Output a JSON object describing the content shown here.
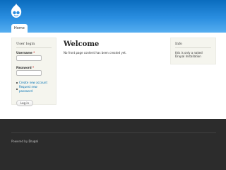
{
  "header": {
    "nav_tabs": [
      {
        "label": "Home"
      }
    ]
  },
  "sidebar_left": {
    "title": "User login",
    "username_label": "Username",
    "password_label": "Password",
    "required_marker": "*",
    "username_value": "",
    "password_value": "",
    "links": [
      {
        "label": "Create new account"
      },
      {
        "label": "Request new password"
      }
    ],
    "login_button": "Log in"
  },
  "main": {
    "title": "Welcome",
    "text": "No front page content has been created yet."
  },
  "sidebar_right": {
    "title": "Info",
    "text": "this is only a naked Drupal Installation"
  },
  "footer": {
    "prefix": "Powered by",
    "link": "Drupal"
  },
  "colors": {
    "header_blue": "#0a6cbe",
    "link_blue": "#0071b3",
    "footer_bg": "#2c2c2c",
    "sidebar_bg": "#f5f5ee"
  }
}
